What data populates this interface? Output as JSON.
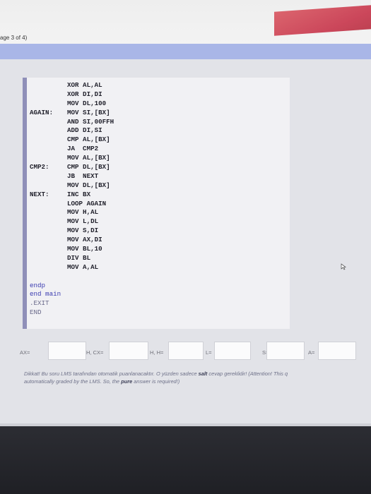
{
  "header": {
    "page_indicator": "age 3 of 4)"
  },
  "code": {
    "lines": [
      {
        "label": "",
        "text": "XOR AL,AL"
      },
      {
        "label": "",
        "text": "XOR DI,DI"
      },
      {
        "label": "",
        "text": "MOV DL,100"
      },
      {
        "label": "AGAIN:",
        "text": "MOV SI,[BX]"
      },
      {
        "label": "",
        "text": "AND SI,00FFH"
      },
      {
        "label": "",
        "text": "ADD DI,SI"
      },
      {
        "label": "",
        "text": "CMP AL,[BX]"
      },
      {
        "label": "",
        "text": "JA  CMP2"
      },
      {
        "label": "",
        "text": "MOV AL,[BX]"
      },
      {
        "label": "CMP2:",
        "text": "CMP DL,[BX]"
      },
      {
        "label": "",
        "text": "JB  NEXT"
      },
      {
        "label": "",
        "text": "MOV DL,[BX]"
      },
      {
        "label": "NEXT:",
        "text": "INC BX"
      },
      {
        "label": "",
        "text": "LOOP AGAIN"
      },
      {
        "label": "",
        "text": "MOV H,AL"
      },
      {
        "label": "",
        "text": "MOV L,DL"
      },
      {
        "label": "",
        "text": "MOV S,DI"
      },
      {
        "label": "",
        "text": "MOV AX,DI"
      },
      {
        "label": "",
        "text": "MOV BL,10"
      },
      {
        "label": "",
        "text": "DIV BL"
      },
      {
        "label": "",
        "text": "MOV A,AL"
      }
    ],
    "tail": [
      "endp",
      "end main"
    ],
    "end_lines": [
      ".EXIT",
      "END"
    ]
  },
  "answers": {
    "fields": [
      {
        "label": "AX=",
        "value": ""
      },
      {
        "label": "H, CX=",
        "value": ""
      },
      {
        "label": "H, H=",
        "value": ""
      },
      {
        "label": "L=",
        "value": ""
      },
      {
        "label": "S=",
        "value": ""
      },
      {
        "label": "A=",
        "value": ""
      }
    ]
  },
  "note": {
    "line1_pre": "Dikkat! Bu soru LMS tarafından otomatik puanlanacaktır. O yüzden sadece ",
    "line1_bold": "salt",
    "line1_post": " cevap gereklidir! (Attention! This q",
    "line2_pre": "automatically graded by the LMS. So, the ",
    "line2_bold": "pure",
    "line2_post": " answer is required!)"
  },
  "colors": {
    "blue_band": "#a9b6e7",
    "code_stripe": "#8f8fb8",
    "red_accent": "#c7344a"
  }
}
